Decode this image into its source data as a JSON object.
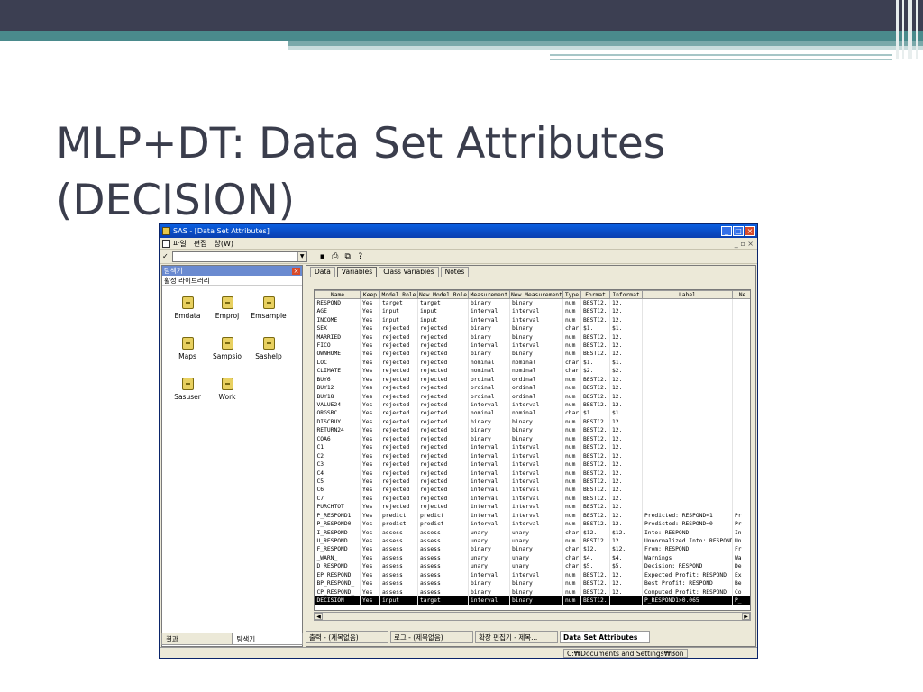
{
  "slide": {
    "title_line1": "MLP+DT: Data Set Attributes",
    "title_line2": "(DECISION)"
  },
  "window": {
    "title": "SAS - [Data Set Attributes]",
    "menu": [
      "파일",
      "편집",
      "창(W)"
    ],
    "check_symbol": "✓",
    "explorer": {
      "header": "탐색기",
      "subheader": "활성 라이브러리",
      "libraries": [
        "Emdata",
        "Emproj",
        "Emsample",
        "Maps",
        "Sampsio",
        "Sashelp",
        "Sasuser",
        "Work"
      ],
      "tabs": [
        "결과",
        "탐색기"
      ]
    },
    "panel_tabs": [
      "Data",
      "Variables",
      "Class Variables",
      "Notes"
    ],
    "columns": [
      "Name",
      "Keep",
      "Model Role",
      "New Model Role",
      "Measurement",
      "New Measurement",
      "Type",
      "Format",
      "Informat",
      "Label",
      "Ne"
    ],
    "rows": [
      [
        "RESPOND",
        "Yes",
        "target",
        "target",
        "binary",
        "binary",
        "num",
        "BEST12.",
        "12.",
        ""
      ],
      [
        "AGE",
        "Yes",
        "input",
        "input",
        "interval",
        "interval",
        "num",
        "BEST12.",
        "12.",
        ""
      ],
      [
        "INCOME",
        "Yes",
        "input",
        "input",
        "interval",
        "interval",
        "num",
        "BEST12.",
        "12.",
        ""
      ],
      [
        "SEX",
        "Yes",
        "rejected",
        "rejected",
        "binary",
        "binary",
        "char",
        "$1.",
        "$1.",
        ""
      ],
      [
        "MARRIED",
        "Yes",
        "rejected",
        "rejected",
        "binary",
        "binary",
        "num",
        "BEST12.",
        "12.",
        ""
      ],
      [
        "FICO",
        "Yes",
        "rejected",
        "rejected",
        "interval",
        "interval",
        "num",
        "BEST12.",
        "12.",
        ""
      ],
      [
        "OWNHOME",
        "Yes",
        "rejected",
        "rejected",
        "binary",
        "binary",
        "num",
        "BEST12.",
        "12.",
        ""
      ],
      [
        "LOC",
        "Yes",
        "rejected",
        "rejected",
        "nominal",
        "nominal",
        "char",
        "$1.",
        "$1.",
        ""
      ],
      [
        "CLIMATE",
        "Yes",
        "rejected",
        "rejected",
        "nominal",
        "nominal",
        "char",
        "$2.",
        "$2.",
        ""
      ],
      [
        "BUY6",
        "Yes",
        "rejected",
        "rejected",
        "ordinal",
        "ordinal",
        "num",
        "BEST12.",
        "12.",
        ""
      ],
      [
        "BUY12",
        "Yes",
        "rejected",
        "rejected",
        "ordinal",
        "ordinal",
        "num",
        "BEST12.",
        "12.",
        ""
      ],
      [
        "BUY18",
        "Yes",
        "rejected",
        "rejected",
        "ordinal",
        "ordinal",
        "num",
        "BEST12.",
        "12.",
        ""
      ],
      [
        "VALUE24",
        "Yes",
        "rejected",
        "rejected",
        "interval",
        "interval",
        "num",
        "BEST12.",
        "12.",
        ""
      ],
      [
        "ORGSRC",
        "Yes",
        "rejected",
        "rejected",
        "nominal",
        "nominal",
        "char",
        "$1.",
        "$1.",
        ""
      ],
      [
        "DISCBUY",
        "Yes",
        "rejected",
        "rejected",
        "binary",
        "binary",
        "num",
        "BEST12.",
        "12.",
        ""
      ],
      [
        "RETURN24",
        "Yes",
        "rejected",
        "rejected",
        "binary",
        "binary",
        "num",
        "BEST12.",
        "12.",
        ""
      ],
      [
        "COA6",
        "Yes",
        "rejected",
        "rejected",
        "binary",
        "binary",
        "num",
        "BEST12.",
        "12.",
        ""
      ],
      [
        "C1",
        "Yes",
        "rejected",
        "rejected",
        "interval",
        "interval",
        "num",
        "BEST12.",
        "12.",
        ""
      ],
      [
        "C2",
        "Yes",
        "rejected",
        "rejected",
        "interval",
        "interval",
        "num",
        "BEST12.",
        "12.",
        ""
      ],
      [
        "C3",
        "Yes",
        "rejected",
        "rejected",
        "interval",
        "interval",
        "num",
        "BEST12.",
        "12.",
        ""
      ],
      [
        "C4",
        "Yes",
        "rejected",
        "rejected",
        "interval",
        "interval",
        "num",
        "BEST12.",
        "12.",
        ""
      ],
      [
        "C5",
        "Yes",
        "rejected",
        "rejected",
        "interval",
        "interval",
        "num",
        "BEST12.",
        "12.",
        ""
      ],
      [
        "C6",
        "Yes",
        "rejected",
        "rejected",
        "interval",
        "interval",
        "num",
        "BEST12.",
        "12.",
        ""
      ],
      [
        "C7",
        "Yes",
        "rejected",
        "rejected",
        "interval",
        "interval",
        "num",
        "BEST12.",
        "12.",
        ""
      ],
      [
        "PURCHTOT",
        "Yes",
        "rejected",
        "rejected",
        "interval",
        "interval",
        "num",
        "BEST12.",
        "12.",
        ""
      ],
      [
        "P_RESPOND1",
        "Yes",
        "predict",
        "predict",
        "interval",
        "interval",
        "num",
        "BEST12.",
        "12.",
        "Predicted: RESPOND=1",
        "Pr"
      ],
      [
        "P_RESPOND0",
        "Yes",
        "predict",
        "predict",
        "interval",
        "interval",
        "num",
        "BEST12.",
        "12.",
        "Predicted: RESPOND=0",
        "Pr"
      ],
      [
        "I_RESPOND",
        "Yes",
        "assess",
        "assess",
        "unary",
        "unary",
        "char",
        "$12.",
        "$12.",
        "Into: RESPOND",
        "In"
      ],
      [
        "U_RESPOND",
        "Yes",
        "assess",
        "assess",
        "unary",
        "unary",
        "num",
        "BEST12.",
        "12.",
        "Unnormalized Into: RESPOND",
        "Un"
      ],
      [
        "F_RESPOND",
        "Yes",
        "assess",
        "assess",
        "binary",
        "binary",
        "char",
        "$12.",
        "$12.",
        "From: RESPOND",
        "Fr"
      ],
      [
        "_WARN_",
        "Yes",
        "assess",
        "assess",
        "unary",
        "unary",
        "char",
        "$4.",
        "$4.",
        "Warnings",
        "Wa"
      ],
      [
        "D_RESPOND_",
        "Yes",
        "assess",
        "assess",
        "unary",
        "unary",
        "char",
        "$5.",
        "$5.",
        "Decision: RESPOND",
        "De"
      ],
      [
        "EP_RESPOND_",
        "Yes",
        "assess",
        "assess",
        "interval",
        "interval",
        "num",
        "BEST12.",
        "12.",
        "Expected Profit: RESPOND",
        "Ex"
      ],
      [
        "BP_RESPOND_",
        "Yes",
        "assess",
        "assess",
        "binary",
        "binary",
        "num",
        "BEST12.",
        "12.",
        "Best Profit: RESPOND",
        "Be"
      ],
      [
        "CP_RESPOND_",
        "Yes",
        "assess",
        "assess",
        "binary",
        "binary",
        "num",
        "BEST12.",
        "12.",
        "Computed Profit: RESPOND",
        "Co"
      ],
      [
        "DECISION",
        "Yes",
        "input",
        "target",
        "interval",
        "binary",
        "num",
        "BEST12.",
        "",
        "P_RESPOND1>0.065",
        "P_"
      ]
    ],
    "selected_row": "DECISION",
    "taskbar": [
      "출력 - (제목없음)",
      "로그 - (제목없음)",
      "확장 편집기 - 제목...",
      "Data Set Attributes"
    ],
    "status_path": "C:₩Documents and Settings₩Bon"
  }
}
